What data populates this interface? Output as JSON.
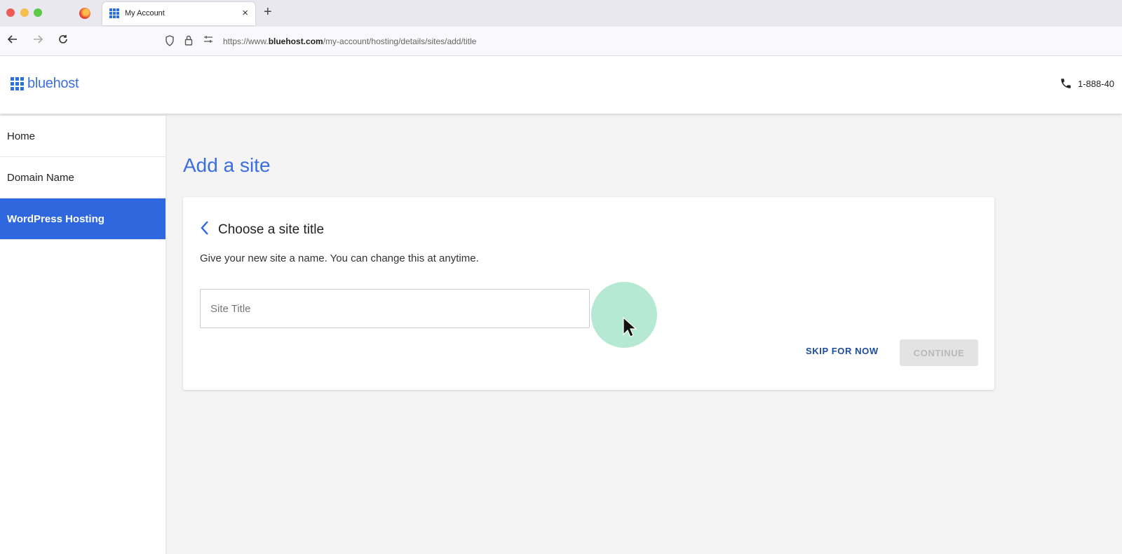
{
  "browser": {
    "tab_title": "My Account",
    "tab_close": "×",
    "new_tab": "+",
    "url_prefix": "https://www.",
    "url_domain": "bluehost.com",
    "url_path": "/my-account/hosting/details/sites/add/title"
  },
  "header": {
    "logo_text": "bluehost",
    "phone": "1-888-40"
  },
  "sidebar": {
    "items": [
      {
        "label": "Home",
        "active": false
      },
      {
        "label": "Domain Name",
        "active": false
      },
      {
        "label": "WordPress Hosting",
        "active": true
      }
    ]
  },
  "main": {
    "page_title": "Add a site",
    "card": {
      "title": "Choose a site title",
      "description": "Give your new site a name. You can change this at anytime.",
      "input_placeholder": "Site Title",
      "input_value": "",
      "skip_label": "SKIP FOR NOW",
      "continue_label": "CONTINUE",
      "continue_disabled": true
    }
  },
  "colors": {
    "brand_blue": "#2f67de",
    "active_nav": "#2f67de",
    "skip_text": "#1c4c9e",
    "cursor_glow": "#78d7af"
  },
  "icons": {
    "back": "arrow-left-icon",
    "forward": "arrow-right-icon",
    "reload": "reload-icon",
    "shield": "shield-icon",
    "lock": "lock-icon",
    "phone": "phone-icon",
    "chevron": "chevron-left-icon"
  }
}
